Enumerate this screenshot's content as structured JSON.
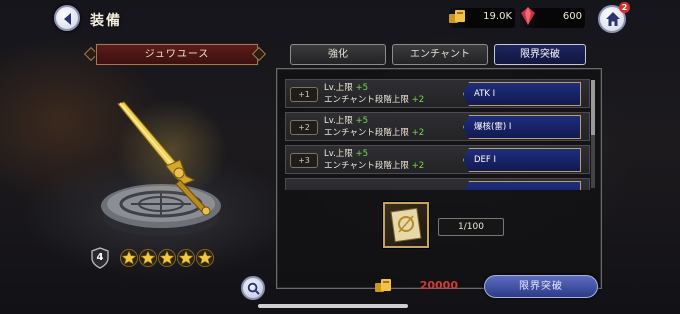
{
  "header": {
    "title": "装備",
    "gold": "19.0K",
    "gems": "600",
    "notification_count": "2"
  },
  "item": {
    "name": "ジュワユース",
    "level": "4",
    "stars": 5
  },
  "tabs": [
    {
      "label": "強化"
    },
    {
      "label": "エンチャント"
    },
    {
      "label": "限界突破",
      "active": true
    }
  ],
  "limit_break_rows": [
    {
      "step": "+1",
      "line1_prefix": "Lv.上限",
      "line1_value": "+5",
      "line2_prefix": "エンチャント段階上限",
      "line2_value": "+2",
      "reward": "ATK I"
    },
    {
      "step": "+2",
      "line1_prefix": "Lv.上限",
      "line1_value": "+5",
      "line2_prefix": "エンチャント段階上限",
      "line2_value": "+2",
      "reward": "爆核(雷) I"
    },
    {
      "step": "+3",
      "line1_prefix": "Lv.上限",
      "line1_value": "+5",
      "line2_prefix": "エンチャント段階上限",
      "line2_value": "+2",
      "reward": "DEF I"
    }
  ],
  "material": {
    "count": "1/100"
  },
  "footer": {
    "cost": "20000",
    "limit_break_button": "限界突破"
  },
  "colors": {
    "accent_green": "#78d84a",
    "cost_red": "#d23a34",
    "tab_active": "#1e2560",
    "banner": "#5b1c1a"
  }
}
